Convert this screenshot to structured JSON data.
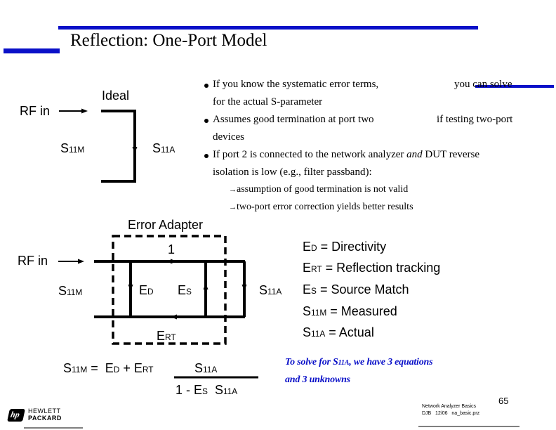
{
  "slide": {
    "title": "Reflection: One-Port Model",
    "accent_color": "#0a10c8",
    "bullets": [
      {
        "line1": "If you know the systematic error terms,",
        "line1b": "you can solve",
        "line2": "for the actual S-parameter"
      },
      {
        "line1": "Assumes good termination at port two",
        "line1b": "if testing two-port",
        "line2": "devices"
      },
      {
        "line1_a": "If port 2 is connected to the network analyzer ",
        "line1_em": "and",
        "line1_b": " DUT reverse",
        "line2": "isolation is low (e.g., filter passband):"
      }
    ],
    "sub_bullets": [
      {
        "arrow": "→",
        "text": "assumption of good termination is not valid"
      },
      {
        "arrow": "→",
        "text": "two-port error correction yields better results"
      }
    ]
  },
  "ideal_diagram": {
    "title": "Ideal",
    "rf_in": "RF in",
    "s11m": {
      "base": "S",
      "sub": "11M"
    },
    "s11a": {
      "base": "S",
      "sub": "11A"
    }
  },
  "error_adapter_diagram": {
    "title": "Error Adapter",
    "rf_in": "RF in",
    "one": "1",
    "s11m": {
      "base": "S",
      "sub": "11M"
    },
    "s11a": {
      "base": "S",
      "sub": "11A"
    },
    "ed": {
      "base": "E",
      "sub": "D"
    },
    "es": {
      "base": "E",
      "sub": "S"
    },
    "ert": {
      "base": "E",
      "sub": "RT"
    }
  },
  "legend": [
    {
      "base": "E",
      "sub": "D",
      "desc": " = Directivity"
    },
    {
      "base": "E",
      "sub": "RT",
      "desc": " = Reflection tracking"
    },
    {
      "base": "E",
      "sub": "S",
      "desc": " = Source Match"
    },
    {
      "base": "S",
      "sub": "11M",
      "desc": " = Measured"
    },
    {
      "base": "S",
      "sub": "11A",
      "desc": " = Actual"
    }
  ],
  "equation": {
    "lhs_base": "S",
    "lhs_sub": "11M",
    "eq": " =  ",
    "ed_base": "E",
    "ed_sub": "D",
    "plus": " + ",
    "ert_base": "E",
    "ert_sub": "RT",
    "num_base": "S",
    "num_sub": "11A",
    "den_prefix": "1 - ",
    "den_es_base": "E",
    "den_es_sub": "S",
    "den_s_base": "S",
    "den_s_sub": "11A"
  },
  "note": {
    "line1_a": "To solve for S",
    "line1_sub": "11A",
    "line1_b": ", we have 3 equations",
    "line2": "and 3 unknowns"
  },
  "footer": {
    "logo_mark": "hp",
    "logo_line1": "HEWLETT",
    "logo_line2": "PACKARD",
    "course": "Network Analyzer Basics",
    "meta": "DJB   12/06   na_basic.prz",
    "page_number": "65"
  }
}
